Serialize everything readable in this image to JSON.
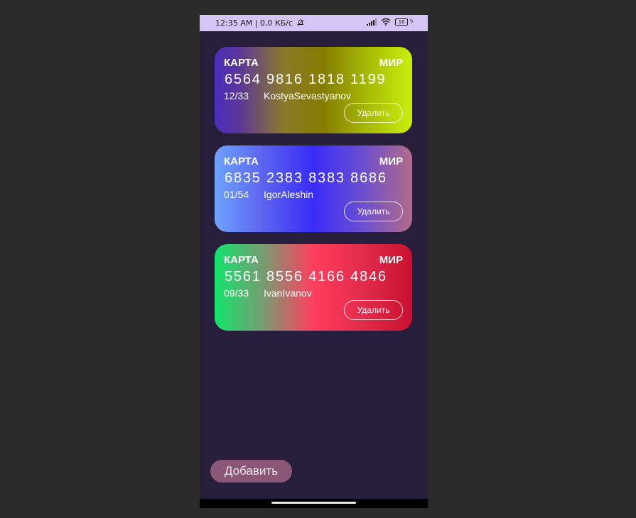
{
  "status_bar": {
    "time_text": "12:35 AM | 0,0 КБ/с",
    "battery_level": "16",
    "icons": [
      "mute-bell-icon",
      "signal-icon",
      "wifi-icon",
      "battery-icon",
      "charging-bolt-icon"
    ]
  },
  "cards": [
    {
      "label": "КАРТА",
      "brand": "МИР",
      "number": "6564 9816 1818 1199",
      "expiry": "12/33",
      "holder": "KostyaSevastyanov",
      "delete_label": "Удалить"
    },
    {
      "label": "КАРТА",
      "brand": "МИР",
      "number": "6835 2383 8383 8686",
      "expiry": "01/54",
      "holder": "IgorAleshin",
      "delete_label": "Удалить"
    },
    {
      "label": "КАРТА",
      "brand": "МИР",
      "number": "5561 8556 4166 4846",
      "expiry": "09/33",
      "holder": "IvanIvanov",
      "delete_label": "Удалить"
    }
  ],
  "add_button": {
    "label": "Добавить"
  },
  "colors": {
    "background": "#271e3c",
    "status_bar": "#d7c4f7",
    "add_button": "#8b5677"
  }
}
